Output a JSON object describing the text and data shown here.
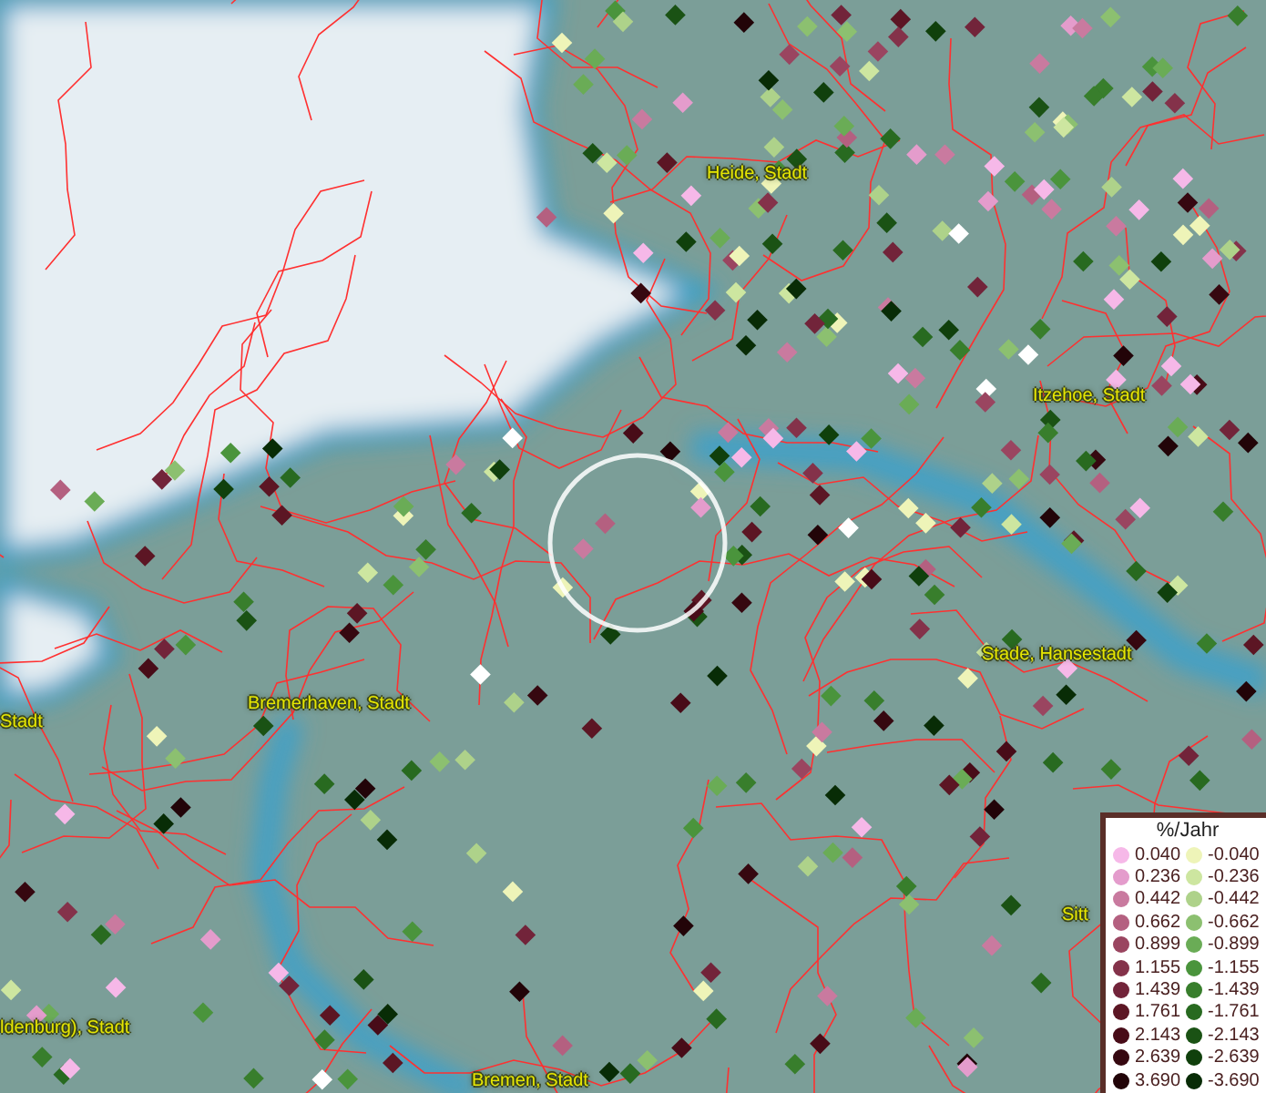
{
  "map": {
    "place_labels": [
      {
        "text": "Heide, Stadt"
      },
      {
        "text": "Itzehoe, Stadt"
      },
      {
        "text": "Stade, Hansestadt"
      },
      {
        "text": "Bremerhaven, Stadt"
      },
      {
        "text": "Stadt"
      },
      {
        "text": "ldenburg), Stadt"
      },
      {
        "text": "Bremen, Stadt"
      },
      {
        "text": "Sitt"
      }
    ]
  },
  "legend": {
    "title": "%/Jahr",
    "positive": [
      {
        "value": "0.040",
        "color": "#f6b8e8"
      },
      {
        "value": "0.236",
        "color": "#e49ccc"
      },
      {
        "value": "0.442",
        "color": "#c97a9f"
      },
      {
        "value": "0.662",
        "color": "#b46080"
      },
      {
        "value": "0.899",
        "color": "#9a4560"
      },
      {
        "value": "1.155",
        "color": "#84324a"
      },
      {
        "value": "1.439",
        "color": "#72243a"
      },
      {
        "value": "1.761",
        "color": "#5c1624"
      },
      {
        "value": "2.143",
        "color": "#480c18"
      },
      {
        "value": "2.639",
        "color": "#360810"
      },
      {
        "value": "3.690",
        "color": "#220408"
      }
    ],
    "negative": [
      {
        "value": "-0.040",
        "color": "#eef4b8"
      },
      {
        "value": "-0.236",
        "color": "#cde6a0"
      },
      {
        "value": "-0.442",
        "color": "#aed28a"
      },
      {
        "value": "-0.662",
        "color": "#8cc070"
      },
      {
        "value": "-0.899",
        "color": "#6aac56"
      },
      {
        "value": "-1.155",
        "color": "#4a943c"
      },
      {
        "value": "-1.439",
        "color": "#387e2c"
      },
      {
        "value": "-1.761",
        "color": "#286a20"
      },
      {
        "value": "-2.143",
        "color": "#1a5214"
      },
      {
        "value": "-2.639",
        "color": "#10400c"
      },
      {
        "value": "-3.690",
        "color": "#082c06"
      }
    ]
  }
}
